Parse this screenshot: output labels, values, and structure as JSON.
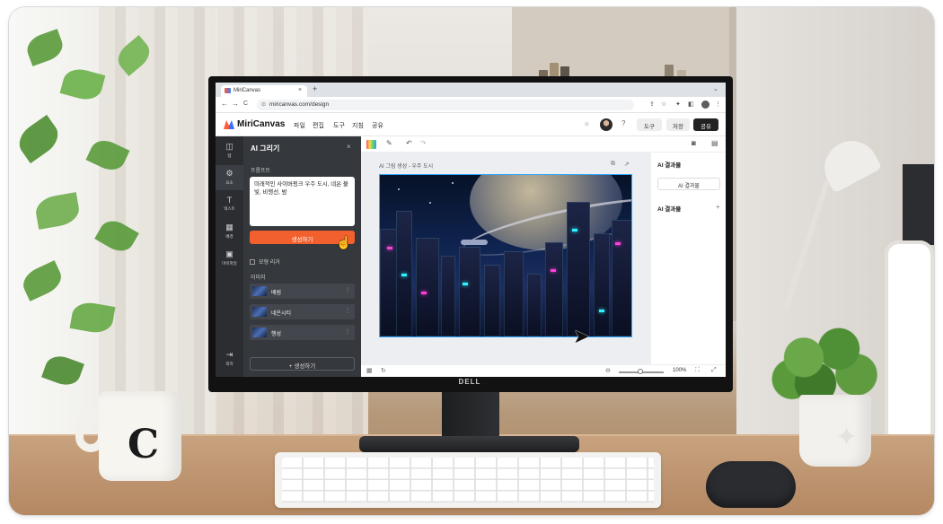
{
  "scene": {
    "mug_letter": "C",
    "monitor_brand": "DELL"
  },
  "browser": {
    "tab_title": "MiriCanvas",
    "tab_close": "×",
    "new_tab": "+",
    "url": "miricanvas.com/design",
    "back": "←",
    "forward": "→",
    "reload": "C"
  },
  "app": {
    "logo": "MiriCanvas",
    "menu": [
      "파일",
      "편집",
      "도구",
      "지침",
      "공유"
    ],
    "tools_button": "도구",
    "save_button": "저장",
    "share_button": "공유",
    "help_icon": "?"
  },
  "rail": {
    "items": [
      {
        "icon": "layout-icon",
        "glyph": "◫",
        "label": "템"
      },
      {
        "icon": "elements-icon",
        "glyph": "⚙",
        "label": "요소"
      },
      {
        "icon": "text-icon",
        "glyph": "T",
        "label": "텍스트"
      },
      {
        "icon": "background-icon",
        "glyph": "▦",
        "label": "배경"
      },
      {
        "icon": "folder-icon",
        "glyph": "▣",
        "label": "마이파일"
      },
      {
        "icon": "exit-icon",
        "glyph": "⇥",
        "label": "최지"
      }
    ]
  },
  "panel": {
    "title": "AI 그리기",
    "close": "×",
    "prompt_label": "프롬프트",
    "prompt_text": "미래적인 사이버펑크 우주 도시, 네온 불빛, 비행선, 밤",
    "generate_button": "생성하기",
    "checkbox_label": "모형 리거",
    "history_label": "이미지",
    "history": [
      {
        "label": "배럼"
      },
      {
        "label": "네온시티"
      },
      {
        "label": "행성"
      }
    ],
    "create_button": "+ 생성하기"
  },
  "canvas": {
    "title": "AI 그림 생성 - 우주 도시"
  },
  "right_panel": {
    "section1_title": "AI 결과물",
    "button": "AI 결과물",
    "section2_title": "AI 결과물",
    "plus": "+"
  },
  "statusbar": {
    "zoom_out": "⊖",
    "zoom_value": "100%",
    "zoom_level": 0.5
  }
}
